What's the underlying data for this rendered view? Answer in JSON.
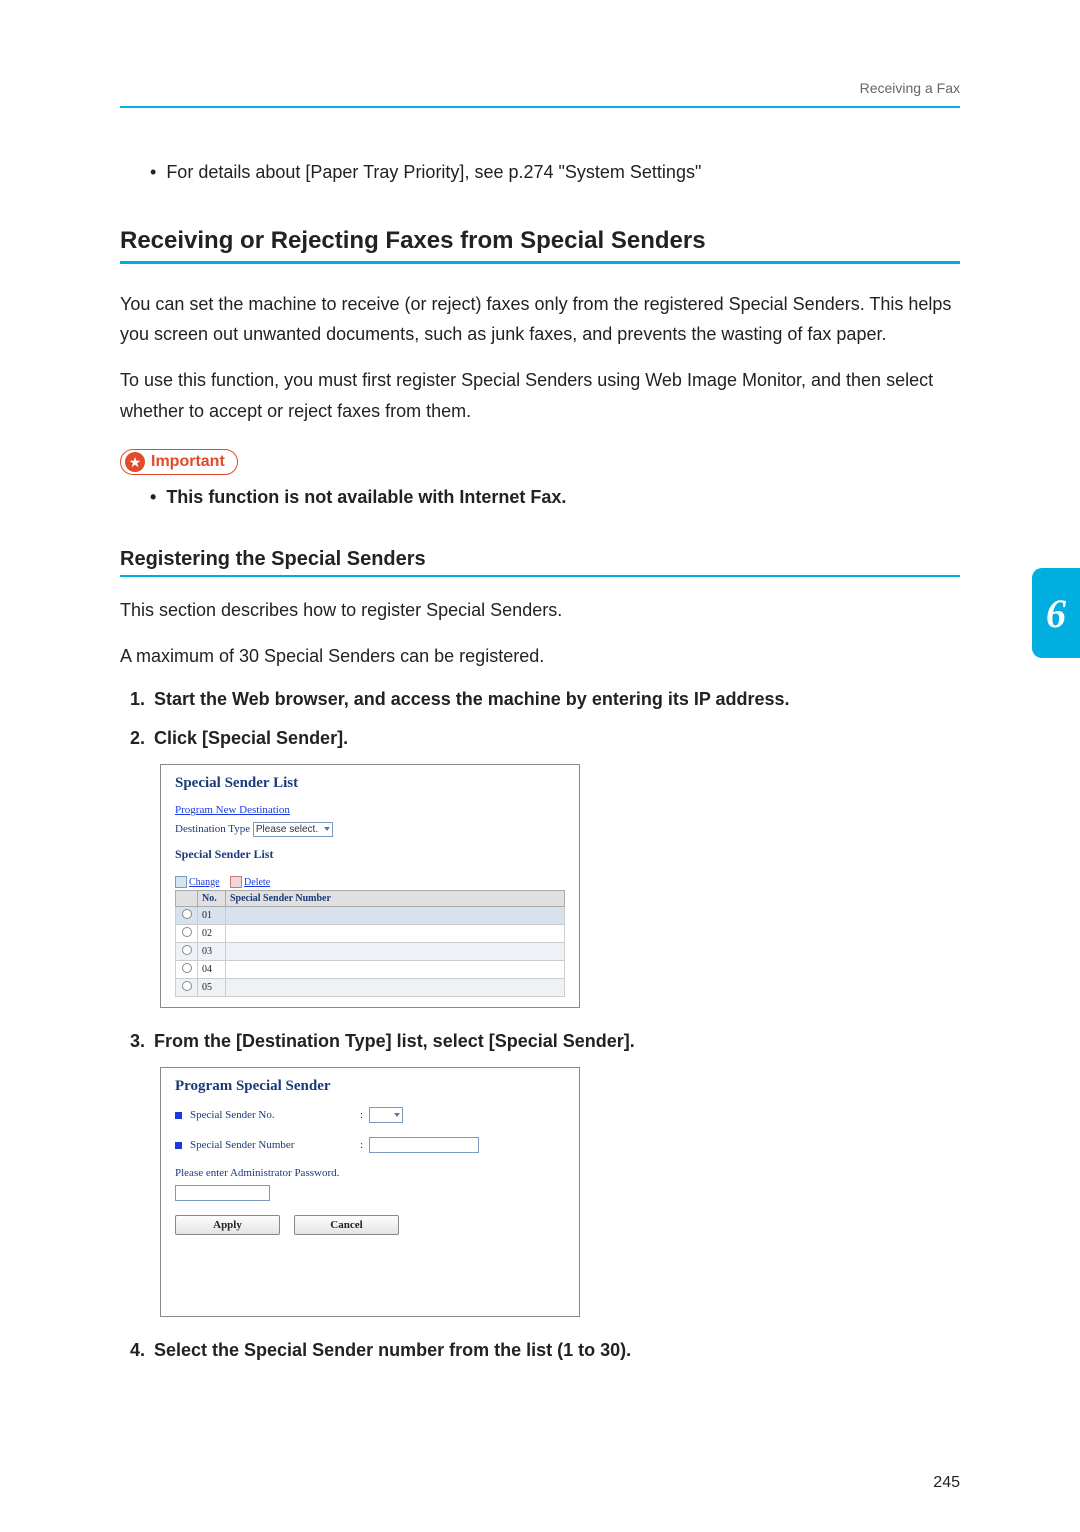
{
  "header": {
    "breadcrumb": "Receiving a Fax"
  },
  "bullet1": "For details about [Paper Tray Priority], see p.274 \"System Settings\"",
  "section": {
    "title": "Receiving or Rejecting Faxes from Special Senders",
    "p1": "You can set the machine to receive (or reject) faxes only from the registered Special Senders. This helps you screen out unwanted documents, such as junk faxes, and prevents the wasting of fax paper.",
    "p2": "To use this function, you must first register Special Senders using Web Image Monitor, and then select whether to accept or reject faxes from them."
  },
  "important": {
    "label": "Important",
    "bullet": "This function is not available with Internet Fax."
  },
  "subsection": {
    "title": "Registering the Special Senders",
    "p1": "This section describes how to register Special Senders.",
    "p2": "A maximum of 30 Special Senders can be registered."
  },
  "steps": {
    "s1": "Start the Web browser, and access the machine by entering its IP address.",
    "s2": "Click [Special Sender].",
    "s3": "From the [Destination Type] list, select [Special Sender].",
    "s4": "Select the Special Sender number from the list (1 to 30)."
  },
  "screenshot1": {
    "title": "Special Sender List",
    "program_link": "Program New Destination",
    "dest_label": "Destination Type",
    "dest_value": "Please select.",
    "sub_title": "Special Sender List",
    "change": "Change",
    "delete": "Delete",
    "th_no": "No.",
    "th_num": "Special Sender Number",
    "rows": [
      "01",
      "02",
      "03",
      "04",
      "05"
    ]
  },
  "screenshot2": {
    "title": "Program Special Sender",
    "row1_label": "Special Sender No.",
    "row2_label": "Special Sender Number",
    "pass_label": "Please enter Administrator Password.",
    "apply": "Apply",
    "cancel": "Cancel"
  },
  "chapter": "6",
  "page_number": "245"
}
